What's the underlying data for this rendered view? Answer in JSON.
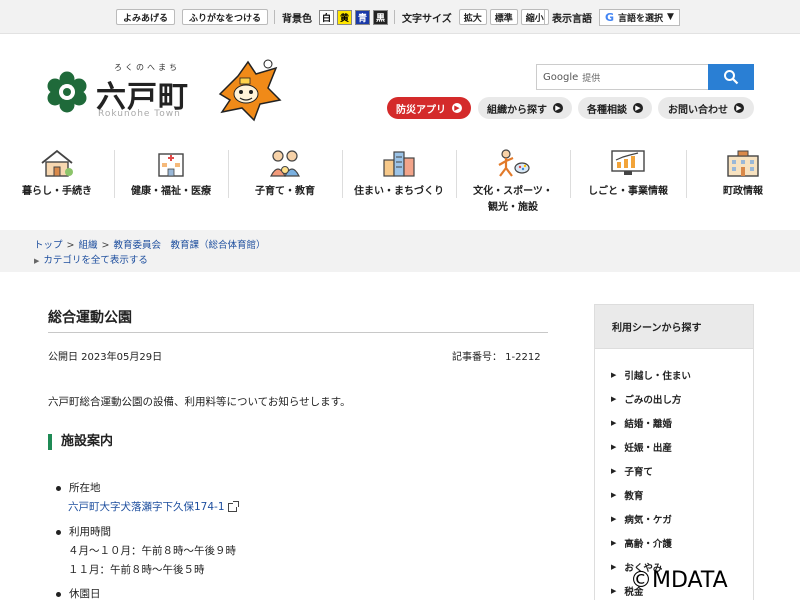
{
  "util": {
    "read_aloud": "よみあげる",
    "furigana": "ふりがなをつける",
    "bg_color_label": "背景色",
    "bg_colors": [
      "白",
      "黄",
      "青",
      "黒"
    ],
    "text_size_label": "文字サイズ",
    "text_sizes": [
      "拡大",
      "標準",
      "縮小"
    ],
    "language_label": "表示言語",
    "language_select": "言語を選択"
  },
  "header": {
    "ruby": "ろくのへまち",
    "town_name": "六戸町",
    "town_roman": "Rokunohe Town",
    "search_placeholder_brand": "Google",
    "search_placeholder_text": "提供",
    "buttons": [
      "防災アプリ",
      "組織から探す",
      "各種相談",
      "お問い合わせ"
    ]
  },
  "gnav": [
    {
      "label": "暮らし・手続き",
      "icon": "house-icon"
    },
    {
      "label": "健康・福祉・医療",
      "icon": "hospital-icon"
    },
    {
      "label": "子育て・教育",
      "icon": "family-icon"
    },
    {
      "label": "住まい・まちづくり",
      "icon": "buildings-icon"
    },
    {
      "label1": "文化・スポーツ・",
      "label2": "観光・施設",
      "icon": "sports-icon"
    },
    {
      "label": "しごと・事業情報",
      "icon": "monitor-chart-icon"
    },
    {
      "label": "町政情報",
      "icon": "townhall-icon"
    }
  ],
  "breadcrumb": {
    "top": "トップ",
    "org": "組織",
    "dept": "教育委員会　教育課（総合体育館）",
    "show_all": "カテゴリを全て表示する"
  },
  "page": {
    "title": "総合運動公園",
    "published": "公開日 2023年05月29日",
    "article_no": "記事番号： 1-2212",
    "intro": "六戸町総合運動公園の設備、利用料等についてお知らせします。",
    "section": "施設案内",
    "loc_label": "所在地",
    "loc_value": "六戸町大字犬落瀬字下久保174-1",
    "hours_label": "利用時間",
    "hours_1": "４月～１０月：午前８時～午後９時",
    "hours_2": "１１月：午前８時～午後５時",
    "closed_label": "休園日"
  },
  "side": {
    "heading": "利用シーンから探す",
    "items": [
      "引越し・住まい",
      "ごみの出し方",
      "結婚・離婚",
      "妊娠・出産",
      "子育て",
      "教育",
      "病気・ケガ",
      "高齢・介護",
      "おくやみ",
      "税金"
    ]
  },
  "copyright": "©MDATA",
  "colors": {
    "accent_green": "#1f8a55",
    "disaster_red": "#d42a2a",
    "search_blue": "#2a7fd4",
    "link_blue": "#1d4e9e"
  }
}
